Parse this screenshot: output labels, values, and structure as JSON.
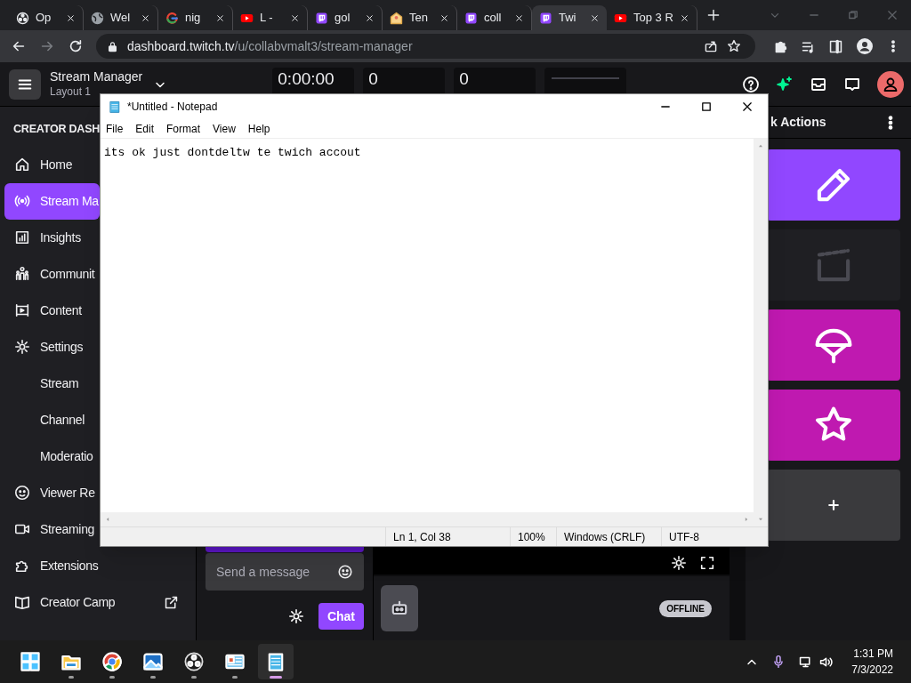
{
  "browser": {
    "tabs": [
      {
        "title": "Op",
        "kind": "obs",
        "selected": false
      },
      {
        "title": "Wel",
        "kind": "globe",
        "selected": false
      },
      {
        "title": "nig",
        "kind": "google",
        "selected": false
      },
      {
        "title": "L -",
        "kind": "youtube",
        "selected": false
      },
      {
        "title": "gol",
        "kind": "twitch",
        "selected": false
      },
      {
        "title": "Ten",
        "kind": "mail",
        "selected": false
      },
      {
        "title": "coll",
        "kind": "twitch",
        "selected": false
      },
      {
        "title": "Twi",
        "kind": "twitch",
        "selected": true
      },
      {
        "title": "Top 3 R",
        "kind": "youtube",
        "selected": false
      }
    ],
    "address": {
      "host": "dashboard.twitch.tv",
      "path": "/u/collabvmalt3/stream-manager"
    }
  },
  "header": {
    "title": "Stream Manager",
    "subtitle": "Layout 1",
    "stats": [
      {
        "value": "0:00:00"
      },
      {
        "value": "0"
      },
      {
        "value": "0"
      },
      {
        "kind": "sparkline"
      }
    ]
  },
  "sidebar": {
    "heading": "CREATOR DASH",
    "items": [
      {
        "label": "Home",
        "kind": "home",
        "selected": false
      },
      {
        "label": "Stream Ma",
        "kind": "broadcast",
        "selected": true
      },
      {
        "label": "Insights",
        "kind": "chart",
        "selected": false
      },
      {
        "label": "Communit",
        "kind": "people",
        "selected": false
      },
      {
        "label": "Content",
        "kind": "film",
        "selected": false
      },
      {
        "label": "Settings",
        "kind": "gear",
        "selected": false,
        "children": [
          {
            "label": "Stream",
            "selected": false
          },
          {
            "label": "Channel",
            "selected": false
          },
          {
            "label": "Moderatio",
            "selected": false
          }
        ]
      },
      {
        "label": "Viewer Re",
        "kind": "face",
        "selected": false
      },
      {
        "label": "Streaming",
        "kind": "camera",
        "selected": false
      },
      {
        "label": "Extensions",
        "kind": "puzzle",
        "selected": false
      },
      {
        "label": "Creator Camp",
        "kind": "book",
        "selected": false,
        "external": true
      }
    ]
  },
  "chat": {
    "placeholder": "Send a message",
    "button": "Chat"
  },
  "activity": {
    "status": "OFFLINE"
  },
  "quick_actions": {
    "title": "k Actions",
    "tiles": [
      {
        "kind": "pencil",
        "color": "#9147ff",
        "disabled": false
      },
      {
        "kind": "clapper",
        "color": "#1f1f23",
        "disabled": true
      },
      {
        "kind": "parachute",
        "color": "#bf19b0",
        "disabled": false
      },
      {
        "kind": "star",
        "color": "#bf19b0",
        "disabled": false
      },
      {
        "kind": "plus",
        "color": "#3a3a3d",
        "disabled": false
      }
    ]
  },
  "notepad": {
    "title": "*Untitled - Notepad",
    "menu": [
      "File",
      "Edit",
      "Format",
      "View",
      "Help"
    ],
    "text": "its ok just dontdeltw te twich accout",
    "status": [
      "Ln 1, Col 38",
      "100%",
      "Windows (CRLF)",
      "UTF-8"
    ]
  },
  "taskbar": {
    "apps": [
      {
        "kind": "start",
        "selected": false
      },
      {
        "kind": "folder",
        "selected": false
      },
      {
        "kind": "chrome",
        "selected": false
      },
      {
        "kind": "photos",
        "selected": false
      },
      {
        "kind": "obs",
        "selected": false
      },
      {
        "kind": "control-panel",
        "selected": false
      },
      {
        "kind": "notepad",
        "selected": true
      }
    ],
    "time": "1:31 PM",
    "date": "7/3/2022"
  }
}
